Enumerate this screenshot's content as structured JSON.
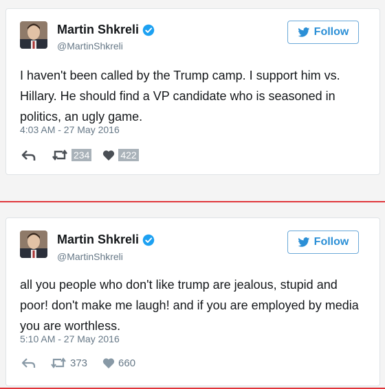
{
  "tweets": [
    {
      "name": "Martin Shkreli",
      "handle": "@MartinShkreli",
      "follow_label": "Follow",
      "text": "I haven't been called by the Trump camp. I support him vs. Hillary. He should find a VP candidate who is seasoned in politics, an ugly game.",
      "timestamp": "4:03 AM - 27 May 2016",
      "retweets": "234",
      "likes": "422"
    },
    {
      "name": "Martin Shkreli",
      "handle": "@MartinShkreli",
      "follow_label": "Follow",
      "text": "all you people who don't like trump are jealous, stupid and poor! don't make me laugh! and if you are employed by media you are worthless.",
      "timestamp": "5:10 AM - 27 May 2016",
      "retweets": "373",
      "likes": "660"
    }
  ],
  "colors": {
    "link_blue": "#2b8fd6",
    "muted_gray": "#657786",
    "verified_blue": "#1da1f2",
    "divider_red": "#e0343a"
  },
  "icons": [
    "avatar",
    "verified-badge-icon",
    "twitter-bird-icon",
    "reply-icon",
    "retweet-icon",
    "heart-icon"
  ]
}
